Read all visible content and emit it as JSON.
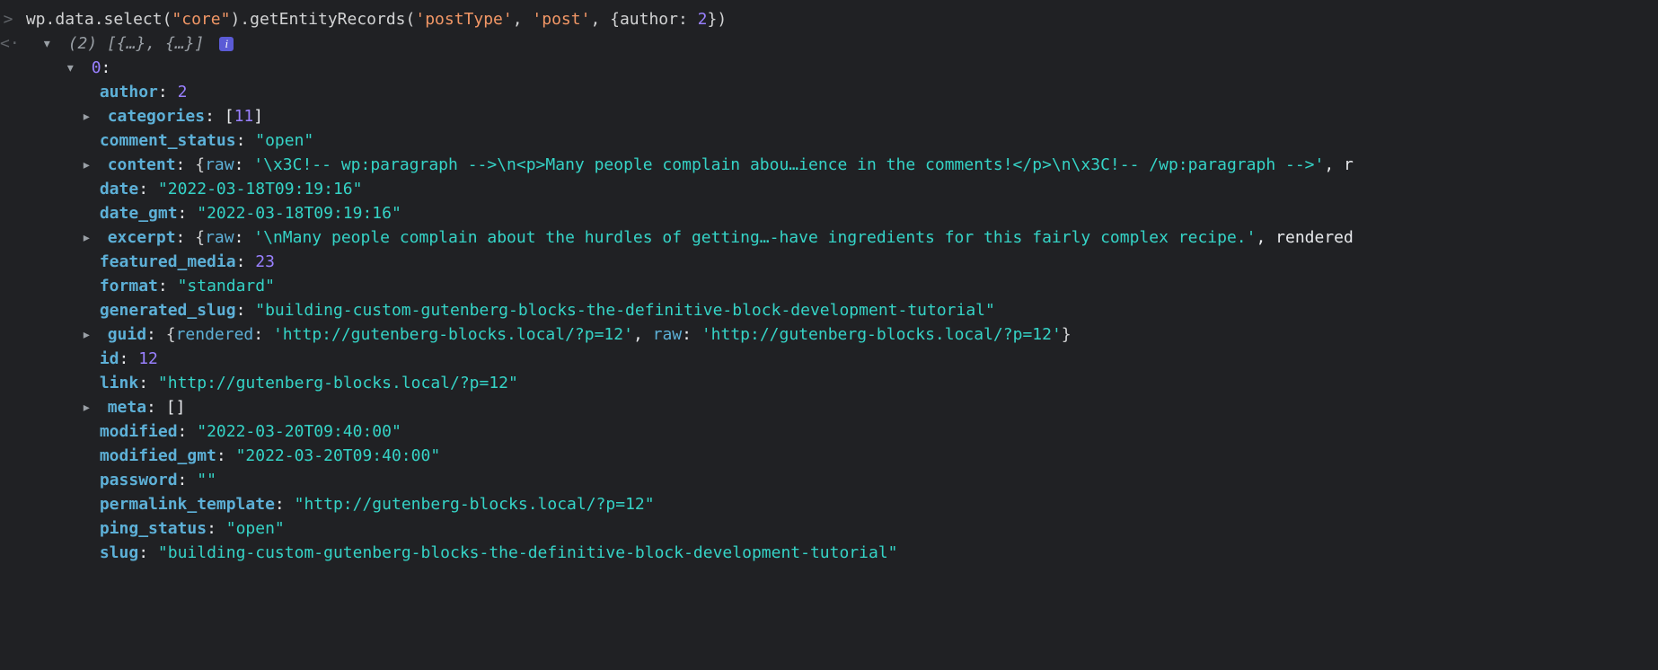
{
  "input": {
    "parts": {
      "p1": "wp",
      "p2": ".data.select(",
      "p3": "\"core\"",
      "p4": ").getEntityRecords(",
      "p5": "'postType'",
      "p6": ", ",
      "p7": "'post'",
      "p8": ", {author: ",
      "p9": "2",
      "p10": "})"
    }
  },
  "summary": {
    "count": "(2)",
    "preview": "[{…}, {…}]"
  },
  "index0": "0",
  "props": {
    "author": {
      "key": "author",
      "val": "2"
    },
    "categories": {
      "key": "categories",
      "open": "[",
      "val": "11",
      "close": "]"
    },
    "comment_status": {
      "key": "comment_status",
      "val": "\"open\""
    },
    "content": {
      "key": "content",
      "inner_key": "raw",
      "inner_val": "'\\x3C!-- wp:paragraph -->\\n<p>Many people complain abou…ience in the comments!</p>\\n\\x3C!-- /wp:paragraph -->'",
      "trail": ", r"
    },
    "date": {
      "key": "date",
      "val": "\"2022-03-18T09:19:16\""
    },
    "date_gmt": {
      "key": "date_gmt",
      "val": "\"2022-03-18T09:19:16\""
    },
    "excerpt": {
      "key": "excerpt",
      "inner_key": "raw",
      "inner_val": "'\\nMany people complain about the hurdles of getting…-have ingredients for this fairly complex recipe.'",
      "trail": ", rendered"
    },
    "featured_media": {
      "key": "featured_media",
      "val": "23"
    },
    "format": {
      "key": "format",
      "val": "\"standard\""
    },
    "generated_slug": {
      "key": "generated_slug",
      "val": "\"building-custom-gutenberg-blocks-the-definitive-block-development-tutorial\""
    },
    "guid": {
      "key": "guid",
      "k1": "rendered",
      "v1": "'http://gutenberg-blocks.local/?p=12'",
      "k2": "raw",
      "v2": "'http://gutenberg-blocks.local/?p=12'"
    },
    "id": {
      "key": "id",
      "val": "12"
    },
    "link": {
      "key": "link",
      "val": "\"http://gutenberg-blocks.local/?p=12\""
    },
    "meta": {
      "key": "meta",
      "val": "[]"
    },
    "modified": {
      "key": "modified",
      "val": "\"2022-03-20T09:40:00\""
    },
    "modified_gmt": {
      "key": "modified_gmt",
      "val": "\"2022-03-20T09:40:00\""
    },
    "password": {
      "key": "password",
      "val": "\"\""
    },
    "permalink_template": {
      "key": "permalink_template",
      "val": "\"http://gutenberg-blocks.local/?p=12\""
    },
    "ping_status": {
      "key": "ping_status",
      "val": "\"open\""
    },
    "slug": {
      "key": "slug",
      "val": "\"building-custom-gutenberg-blocks-the-definitive-block-development-tutorial\""
    }
  }
}
